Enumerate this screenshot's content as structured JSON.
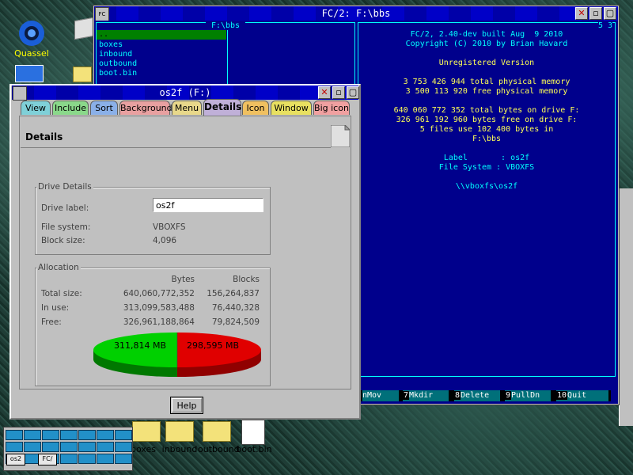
{
  "desktop": {
    "icons": [
      {
        "label": "Quassel"
      }
    ],
    "bottom_icons": [
      {
        "label": "boxes"
      },
      {
        "label": "inbound"
      },
      {
        "label": "outbound"
      },
      {
        "label": "boot.bin"
      }
    ]
  },
  "fc_window": {
    "title": "FC/2: F:\\bbs",
    "left_panel_header": "F:\\bbs",
    "files": [
      "..",
      "boxes",
      "inbound",
      "outbound",
      "boot.bin"
    ],
    "corner_value": "5 3",
    "info_lines": [
      {
        "text": "FC/2, 2.40-dev built Aug  9 2010",
        "color": "cyan"
      },
      {
        "text": "Copyright (C) 2010 by Brian Havard",
        "color": "cyan"
      },
      {
        "text": "",
        "color": "cyan"
      },
      {
        "text": "Unregistered Version",
        "color": "yellow"
      },
      {
        "text": "",
        "color": "cyan"
      },
      {
        "text": "3 753 426 944 total physical memory",
        "color": "yellow"
      },
      {
        "text": "3 500 113 920 free physical memory",
        "color": "yellow"
      },
      {
        "text": "",
        "color": "cyan"
      },
      {
        "text": "640 060 772 352 total bytes on drive F:",
        "color": "yellow"
      },
      {
        "text": "326 961 192 960 bytes free on drive F:",
        "color": "yellow"
      },
      {
        "text": "5 files use 102 400 bytes in",
        "color": "yellow"
      },
      {
        "text": "F:\\bbs",
        "color": "yellow"
      },
      {
        "text": "",
        "color": "cyan"
      },
      {
        "text": "Label       : os2f",
        "color": "cyan"
      },
      {
        "text": "File System : VBOXFS",
        "color": "cyan"
      },
      {
        "text": "",
        "color": "cyan"
      },
      {
        "text": "\\\\vboxfs\\os2f",
        "color": "cyan"
      }
    ],
    "fkeys": [
      {
        "num": "",
        "label": "nMov"
      },
      {
        "num": "7",
        "label": "Mkdir"
      },
      {
        "num": "8",
        "label": "Delete"
      },
      {
        "num": "9",
        "label": "PullDn"
      },
      {
        "num": "10",
        "label": "Quit"
      }
    ]
  },
  "props_window": {
    "title": "os2f (F:)",
    "tabs": [
      {
        "label": "View",
        "color": "#7fd0d8"
      },
      {
        "label": "Include",
        "color": "#8ad88a"
      },
      {
        "label": "Sort",
        "color": "#8ab0e8"
      },
      {
        "label": "Background",
        "color": "#e8a0a0"
      },
      {
        "label": "Menu",
        "color": "#e8d88a"
      },
      {
        "label": "Details",
        "color": "#c0b0d8"
      },
      {
        "label": "Icon",
        "color": "#f0c060"
      },
      {
        "label": "Window",
        "color": "#e8e060"
      },
      {
        "label": "Big icon",
        "color": "#f0a0a0"
      }
    ],
    "active_tab": "Details",
    "page_title": "Details",
    "drive_details": {
      "group_title": "Drive Details",
      "label_caption": "Drive label:",
      "label_value": "os2f",
      "fs_caption": "File system:",
      "fs_value": "VBOXFS",
      "block_caption": "Block size:",
      "block_value": "4,096"
    },
    "allocation": {
      "group_title": "Allocation",
      "col_bytes": "Bytes",
      "col_blocks": "Blocks",
      "rows": [
        {
          "caption": "Total size:",
          "bytes": "640,060,772,352",
          "blocks": "156,264,837"
        },
        {
          "caption": "In use:",
          "bytes": "313,099,583,488",
          "blocks": "76,440,328"
        },
        {
          "caption": "Free:",
          "bytes": "326,961,188,864",
          "blocks": "79,824,509"
        }
      ],
      "pie_used_label": "311,814 MB",
      "pie_free_label": "298,595 MB",
      "used_color": "#00d000",
      "free_color": "#e00000"
    },
    "help_label": "Help"
  },
  "taskbar": {
    "items": [
      "os2",
      "FC/"
    ]
  }
}
